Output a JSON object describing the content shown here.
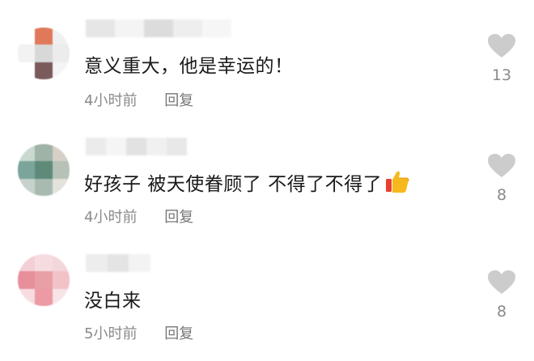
{
  "comments": [
    {
      "text": "意义重大，他是幸运的！",
      "time": "4小时前",
      "reply_label": "回复",
      "likes": "13",
      "has_emoji": false,
      "avatar_colors": [
        "#ffffff",
        "#e0795a",
        "#f0f0f0",
        "#f2f2f2",
        "#d8d8d8",
        "#ececec",
        "#ffffff",
        "#7a5a5a",
        "#f4f4f4"
      ],
      "username_colors": [
        "#e6e6e6",
        "#f4f4f4",
        "#dcdcdc",
        "#eeeeee",
        "#f6f6f6"
      ]
    },
    {
      "text": "好孩子 被天使眷顾了 不得了不得了",
      "time": "4小时前",
      "reply_label": "回复",
      "likes": "8",
      "has_emoji": true,
      "emoji_name": "thumbs-up-icon",
      "avatar_colors": [
        "#c9d9cf",
        "#9fb3a6",
        "#d6d0c6",
        "#7ba59b",
        "#5f8a7a",
        "#b6c2b8",
        "#c7d2cc",
        "#a9bbb0",
        "#e3e3dc"
      ],
      "username_colors": [
        "#ebebeb",
        "#f5f5f5",
        "#e2e2e2",
        "#f0f0f0",
        "#e8e8e8"
      ]
    },
    {
      "text": "没白来",
      "time": "5小时前",
      "reply_label": "回复",
      "likes": "8",
      "has_emoji": false,
      "avatar_colors": [
        "#f4cfd6",
        "#f6dce0",
        "#f3d6da",
        "#e88f9c",
        "#e8a0a6",
        "#f1c3c8",
        "#f7dde0",
        "#ec9aa4",
        "#f6e4e6"
      ],
      "username_colors": [
        "#ededed",
        "#e4e4e4",
        "#f3f3f3"
      ]
    }
  ],
  "colors": {
    "text": "#1a1a1a",
    "meta": "#8a8a8a",
    "like_icon": "#cccccc",
    "background": "#ffffff"
  }
}
